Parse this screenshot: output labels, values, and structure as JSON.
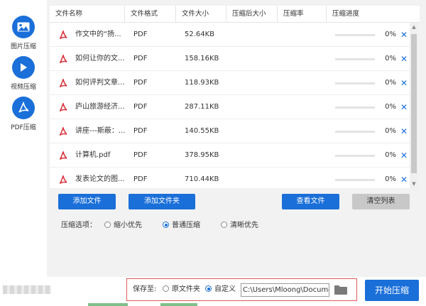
{
  "sidebar": {
    "items": [
      {
        "label": "图片压缩",
        "icon": "image-icon"
      },
      {
        "label": "视频压缩",
        "icon": "play-icon"
      },
      {
        "label": "PDF压缩",
        "icon": "pdf-icon",
        "active": true
      }
    ]
  },
  "table": {
    "columns": [
      "文件名称",
      "文件格式",
      "文件大小",
      "压缩后大小",
      "压缩率",
      "压缩进度"
    ],
    "rows": [
      {
        "name": "作文中的“扬...",
        "format": "PDF",
        "size": "52.64KB",
        "compressed": "",
        "ratio": "",
        "progress": "0%"
      },
      {
        "name": "如何让你的文...",
        "format": "PDF",
        "size": "158.16KB",
        "compressed": "",
        "ratio": "",
        "progress": "0%"
      },
      {
        "name": "如何评判文章...",
        "format": "PDF",
        "size": "118.93KB",
        "compressed": "",
        "ratio": "",
        "progress": "0%"
      },
      {
        "name": "庐山旅游经济...",
        "format": "PDF",
        "size": "287.11KB",
        "compressed": "",
        "ratio": "",
        "progress": "0%"
      },
      {
        "name": "讲座---斯蔽：...",
        "format": "PDF",
        "size": "140.55KB",
        "compressed": "",
        "ratio": "",
        "progress": "0%"
      },
      {
        "name": "计算机.pdf",
        "format": "PDF",
        "size": "378.95KB",
        "compressed": "",
        "ratio": "",
        "progress": "0%"
      },
      {
        "name": "发表论文的图...",
        "format": "PDF",
        "size": "710.44KB",
        "compressed": "",
        "ratio": "",
        "progress": "0%"
      }
    ],
    "remove_icon": "close-icon"
  },
  "actions": {
    "add_file": "添加文件",
    "add_folder": "添加文件夹",
    "view_file": "查看文件",
    "clear_list": "清空列表"
  },
  "compress_options": {
    "label": "压缩选项：",
    "options": [
      {
        "label": "缩小优先",
        "selected": false
      },
      {
        "label": "普通压缩",
        "selected": true
      },
      {
        "label": "清晰优先",
        "selected": false
      }
    ]
  },
  "save": {
    "label": "保存至:",
    "options": [
      {
        "label": "原文件夹",
        "selected": false
      },
      {
        "label": "自定义",
        "selected": true
      }
    ],
    "path": "C:\\Users\\Mloong\\Documents",
    "folder_icon": "folder-icon"
  },
  "start_button": "开始压缩",
  "colors": {
    "accent": "#1a6fd9",
    "pdf_red": "#d9363e",
    "highlight_border": "#e05a5a"
  }
}
